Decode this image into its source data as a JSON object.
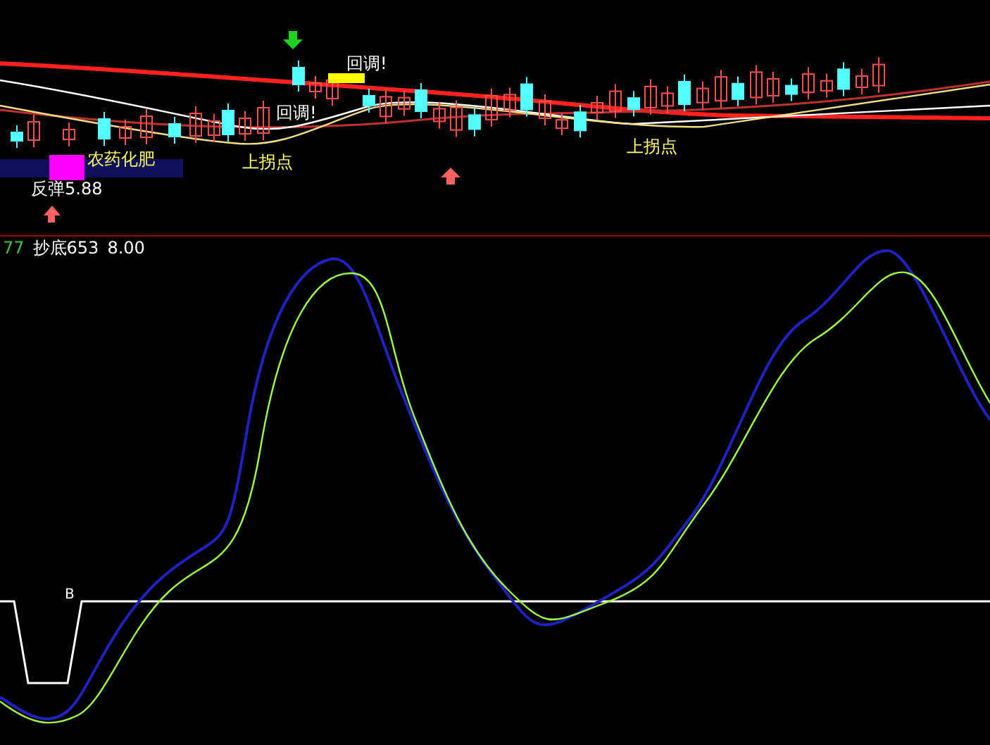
{
  "price_panel": {
    "annotations": [
      {
        "text": "回调!",
        "color": "#ffffff"
      },
      {
        "text": "回调!",
        "color": "#ffffff"
      },
      {
        "text": "农药化肥",
        "color": "#ffff66"
      },
      {
        "text": "上拐点",
        "color": "#ffff66"
      },
      {
        "text": "上拐点",
        "color": "#ffff66"
      },
      {
        "text": "反弹5.88",
        "color": "#ffffff"
      }
    ]
  },
  "indicator_panel": {
    "header": {
      "period": "77",
      "name": "抄底653",
      "value": "8.00"
    },
    "marker": "B"
  }
}
